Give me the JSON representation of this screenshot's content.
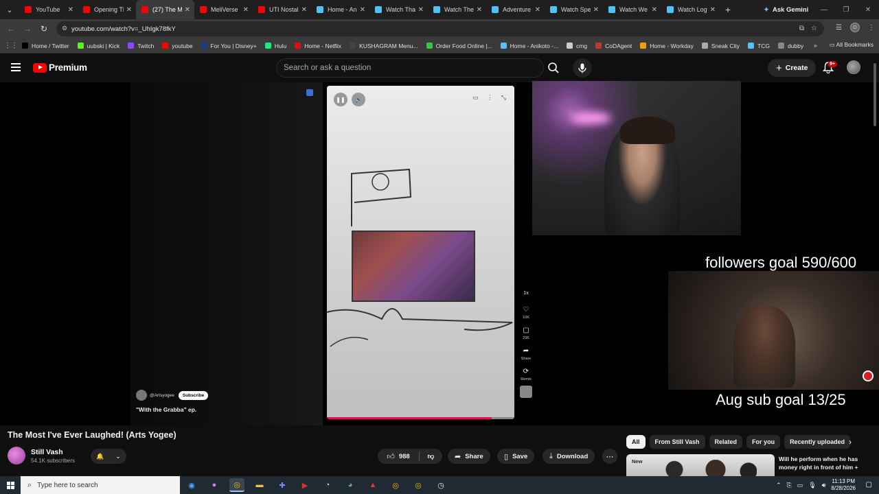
{
  "browser": {
    "tabs": [
      {
        "title": "YouTube",
        "color": "#ff0000"
      },
      {
        "title": "Opening Th",
        "color": "#ff0000"
      },
      {
        "title": "(27) The M",
        "color": "#ff0000"
      },
      {
        "title": "MeliVerse",
        "color": "#ff0000"
      },
      {
        "title": "UTI Nostal",
        "color": "#ff0000"
      },
      {
        "title": "Home - An",
        "color": "#4fc3f7"
      },
      {
        "title": "Watch Tha",
        "color": "#4fc3f7"
      },
      {
        "title": "Watch The",
        "color": "#4fc3f7"
      },
      {
        "title": "Adventure",
        "color": "#4fc3f7"
      },
      {
        "title": "Watch Spe",
        "color": "#4fc3f7"
      },
      {
        "title": "Watch We",
        "color": "#4fc3f7"
      },
      {
        "title": "Watch Log",
        "color": "#4fc3f7"
      }
    ],
    "ask_gemini": "Ask Gemini",
    "url": "youtube.com/watch?v=_UhIgk78fkY",
    "bookmarks": [
      {
        "label": "Home / Twitter",
        "color": "#000000"
      },
      {
        "label": "uubski | Kick",
        "color": "#53fc18"
      },
      {
        "label": "Twitch",
        "color": "#9146ff"
      },
      {
        "label": "youtube",
        "color": "#ff0000"
      },
      {
        "label": "For You | Disney+",
        "color": "#1a3a8a"
      },
      {
        "label": "Hulu",
        "color": "#1ce783"
      },
      {
        "label": "Home - Netflix",
        "color": "#e50914"
      },
      {
        "label": "KUSHAGRAM Menu...",
        "color": "#444444"
      },
      {
        "label": "Order Food Online |...",
        "color": "#2ecc40"
      },
      {
        "label": "Home - Anikoto -...",
        "color": "#4fc3f7"
      },
      {
        "label": "cmg",
        "color": "#cccccc"
      },
      {
        "label": "CoDAgent",
        "color": "#c0392b"
      },
      {
        "label": "Home - Workday",
        "color": "#f39c12"
      },
      {
        "label": "Sneak City",
        "color": "#aaaaaa"
      },
      {
        "label": "TCG",
        "color": "#4fc3f7"
      },
      {
        "label": "dubby",
        "color": "#888888"
      }
    ],
    "all_bookmarks": "All Bookmarks"
  },
  "youtube": {
    "logo_text": "Premium",
    "search_placeholder": "Search or ask a question",
    "create_label": "Create",
    "notif_count": "9+"
  },
  "short": {
    "creator": "@Artsyogee",
    "subscribe": "Subscribe",
    "caption": "\"With the Grabba\" ep.",
    "progress_fraction": 0.88,
    "side_actions": [
      {
        "icon": "speed",
        "label": "1x"
      },
      {
        "icon": "heart",
        "label": "10K"
      },
      {
        "icon": "comment",
        "label": "295"
      },
      {
        "icon": "share",
        "label": "Share"
      },
      {
        "icon": "remix",
        "label": "Remix"
      }
    ]
  },
  "overlay": {
    "followers_goal": "followers goal 590/600",
    "sub_goal": "Aug sub goal 13/25"
  },
  "video": {
    "title": "The Most I've Ever Laughed! (Arts Yogee)",
    "channel": "Still Vash",
    "subscribers": "54.1K subscribers",
    "likes": "988",
    "share": "Share",
    "save": "Save",
    "download": "Download"
  },
  "sidebar": {
    "chips": [
      "All",
      "From Still Vash",
      "Related",
      "For you",
      "Recently uploaded"
    ],
    "rec_badge": "New",
    "rec_title": "Will he perform when he has money right in front of him +"
  },
  "taskbar": {
    "search": "Type here to search",
    "time": "11:13 PM",
    "date": "8/28/2026"
  }
}
